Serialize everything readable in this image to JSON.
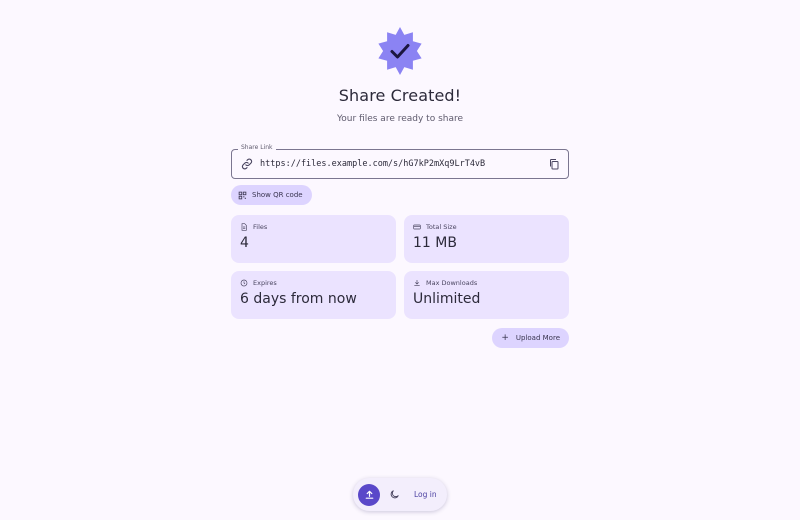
{
  "header": {
    "title": "Share Created!",
    "subtitle": "Your files are ready to share",
    "badge_icon": "verified-check-icon",
    "badge_color": "#8b83f3"
  },
  "share_link": {
    "label": "Share Link",
    "value": "https://files.example.com/s/hG7kP2mXq9LrT4vB",
    "leading_icon": "link-icon",
    "trailing_icon": "copy-icon"
  },
  "qr_button": {
    "label": "Show QR code",
    "icon": "qr-code-icon"
  },
  "stats": {
    "files": {
      "label": "Files",
      "value": "4",
      "icon": "file-icon"
    },
    "total_size": {
      "label": "Total Size",
      "value": "11 MB",
      "icon": "storage-icon"
    },
    "expires": {
      "label": "Expires",
      "value": "6 days from now",
      "icon": "clock-icon"
    },
    "max_downloads": {
      "label": "Max Downloads",
      "value": "Unlimited",
      "icon": "download-icon"
    }
  },
  "upload_more": {
    "label": "Upload More",
    "icon": "plus-icon"
  },
  "dock": {
    "upload_icon": "upload-icon",
    "theme_icon": "moon-icon",
    "login_label": "Log in",
    "accent": "#5a48c9"
  }
}
